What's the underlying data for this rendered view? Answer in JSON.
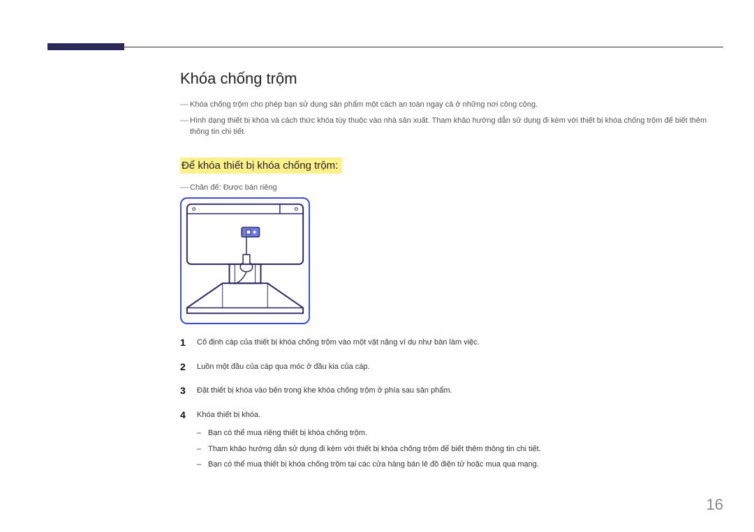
{
  "page_number": "16",
  "title": "Khóa chống trộm",
  "notes": [
    "Khóa chống trộm cho phép bạn sử dụng sản phẩm một cách an toàn ngay cả ở những nơi công cộng.",
    "Hình dạng thiết bị khóa và cách thức khóa tùy thuộc vào nhà sản xuất. Tham khảo hướng dẫn sử dụng đi kèm với thiết bị khóa chống trộm để biết thêm thông tin chi tiết."
  ],
  "subtitle": "Để khóa thiết bị khóa chống trộm:",
  "stand_note": "Chân đế: Được bán riêng",
  "steps": [
    "Cố định cáp của thiết bị khóa chống trộm vào một vật nặng ví dụ như bàn làm việc.",
    "Luồn một đầu của cáp qua móc ở đầu kia của cáp.",
    "Đặt thiết bị khóa vào bên trong khe khóa chống trộm ở phía sau sản phẩm.",
    "Khóa thiết bị khóa."
  ],
  "sub_notes": [
    "Bạn có thể mua riêng thiết bị khóa chống trộm.",
    "Tham khảo hướng dẫn sử dụng đi kèm với thiết bị khóa chống trộm để biết thêm thông tin chi tiết.",
    "Bạn có thể mua thiết bị khóa chống trộm tại các cửa hàng bán lẻ đồ điện tử hoặc mua qua mạng."
  ]
}
